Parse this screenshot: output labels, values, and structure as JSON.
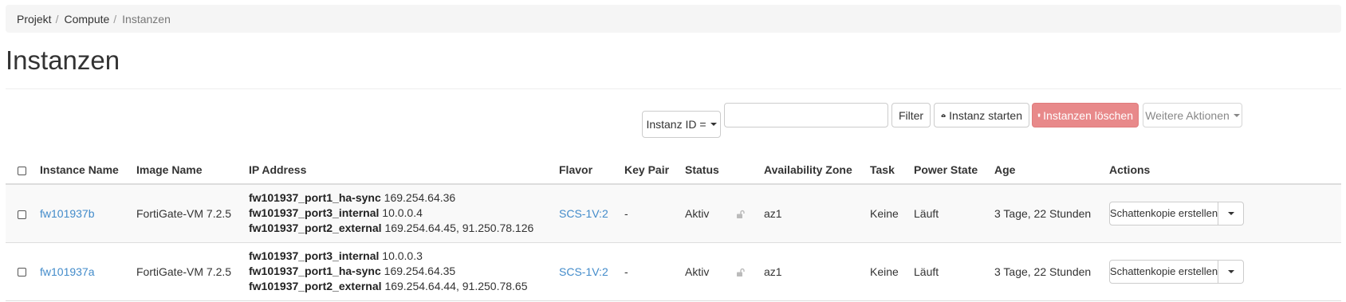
{
  "breadcrumb": [
    {
      "label": "Projekt"
    },
    {
      "label": "Compute"
    },
    {
      "label": "Instanzen"
    }
  ],
  "page_title": "Instanzen",
  "toolbar": {
    "filter_field_label": "Instanz ID =",
    "filter_value": "",
    "filter_button": "Filter",
    "launch_button": "Instanz starten",
    "delete_button": "Instanzen löschen",
    "more_actions_button": "Weitere Aktionen"
  },
  "table": {
    "columns": {
      "instance_name": "Instance Name",
      "image_name": "Image Name",
      "ip_address": "IP Address",
      "flavor": "Flavor",
      "key_pair": "Key Pair",
      "status": "Status",
      "availability_zone": "Availability Zone",
      "task": "Task",
      "power_state": "Power State",
      "age": "Age",
      "actions": "Actions"
    },
    "rows": [
      {
        "name": "fw101937b",
        "image": "FortiGate-VM 7.2.5",
        "ips": [
          {
            "net": "fw101937_port1_ha-sync",
            "addr": "169.254.64.36"
          },
          {
            "net": "fw101937_port3_internal",
            "addr": "10.0.0.4"
          },
          {
            "net": "fw101937_port2_external",
            "addr": "169.254.64.45, 91.250.78.126"
          }
        ],
        "flavor": "SCS-1V:2",
        "key_pair": "-",
        "status": "Aktiv",
        "az": "az1",
        "task": "Keine",
        "power_state": "Läuft",
        "age": "3 Tage, 22 Stunden",
        "action": "Schattenkopie erstellen"
      },
      {
        "name": "fw101937a",
        "image": "FortiGate-VM 7.2.5",
        "ips": [
          {
            "net": "fw101937_port3_internal",
            "addr": "10.0.0.3"
          },
          {
            "net": "fw101937_port1_ha-sync",
            "addr": "169.254.64.35"
          },
          {
            "net": "fw101937_port2_external",
            "addr": "169.254.64.44, 91.250.78.65"
          }
        ],
        "flavor": "SCS-1V:2",
        "key_pair": "-",
        "status": "Aktiv",
        "az": "az1",
        "task": "Keine",
        "power_state": "Läuft",
        "age": "3 Tage, 22 Stunden",
        "action": "Schattenkopie erstellen"
      }
    ]
  },
  "icons": {
    "launch": "cloud-upload-icon",
    "delete": "trash-icon",
    "status_lock": "unlocked-icon"
  },
  "colors": {
    "link": "#428bca",
    "danger": "#e8898a"
  }
}
